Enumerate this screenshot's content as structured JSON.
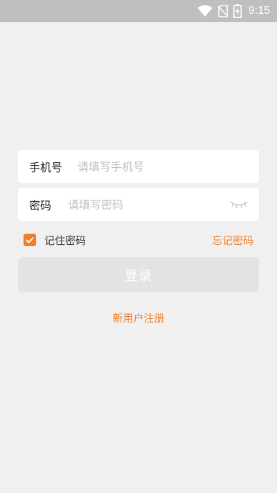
{
  "status_bar": {
    "time": "9:15",
    "icons": [
      "wifi-icon",
      "no-sim-icon",
      "battery-charging-icon"
    ]
  },
  "login_form": {
    "phone": {
      "label": "手机号",
      "placeholder": "请填写手机号",
      "value": ""
    },
    "password": {
      "label": "密码",
      "placeholder": "请填写密码",
      "value": "",
      "toggle_icon": "eye-closed-icon"
    },
    "remember_label": "记住密码",
    "remember_checked": true,
    "forgot_label": "忘记密码",
    "login_label": "登录",
    "register_label": "新用户注册"
  },
  "colors": {
    "accent": "#f07d2a",
    "status_bar": "#bfbfbf",
    "background": "#f0f0f0",
    "button_disabled": "#e3e3e3"
  }
}
